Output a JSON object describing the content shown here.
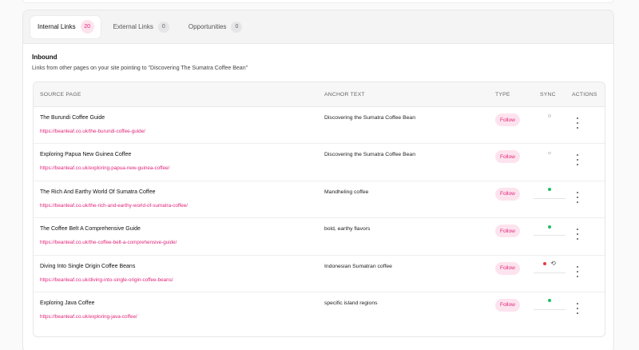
{
  "tabs": [
    {
      "label": "Internal Links",
      "count": "20"
    },
    {
      "label": "External Links",
      "count": "0"
    },
    {
      "label": "Opportunities",
      "count": "0"
    }
  ],
  "section": {
    "title": "Inbound",
    "description": "Links from other pages on your site pointing to \"Discovering The Sumatra Coffee Bean\""
  },
  "table": {
    "headers": {
      "source": "SOURCE PAGE",
      "anchor": "ANCHOR TEXT",
      "type": "TYPE",
      "sync": "SYNC",
      "actions": "ACTIONS"
    },
    "rows": [
      {
        "title": "The Burundi Coffee Guide",
        "url": "https://beanleaf.co.uk/the-burundi-coffee-guide/",
        "anchor": "Discovering the Sumatra Coffee Bean",
        "type": "Follow",
        "sync": "pending",
        "sync_icon": "refresh-icon"
      },
      {
        "title": "Exploring Papua New Guinea Coffee",
        "url": "https://beanleaf.co.uk/exploring-papua-new-guinea-coffee/",
        "anchor": "Discovering the Sumatra Coffee Bean",
        "type": "Follow",
        "sync": "pending",
        "sync_icon": "refresh-icon"
      },
      {
        "title": "The Rich And Earthy World Of Sumatra Coffee",
        "url": "https://beanleaf.co.uk/the-rich-and-earthy-world-of-sumatra-coffee/",
        "anchor": "Mandheling coffee",
        "type": "Follow",
        "sync": "synced",
        "sync_icon": "refresh-icon"
      },
      {
        "title": "The Coffee Belt A Comprehensive Guide",
        "url": "https://beanleaf.co.uk/the-coffee-belt-a-comprehensive-guide/",
        "anchor": "bold, earthy flavors",
        "type": "Follow",
        "sync": "synced",
        "sync_icon": "refresh-icon"
      },
      {
        "title": "Diving Into Single Origin Coffee Beans",
        "url": "https://beanleaf.co.uk/diving-into-single-origin-coffee-beans/",
        "anchor": "Indonesian Sumatran coffee",
        "type": "Follow",
        "sync": "error",
        "sync_icon": "refresh-icon",
        "sync_glyph": "⟲"
      },
      {
        "title": "Exploring Java Coffee",
        "url": "https://beanleaf.co.uk/exploring-java-coffee/",
        "anchor": "specific island regions",
        "type": "Follow",
        "sync": "synced",
        "sync_icon": "refresh-icon"
      }
    ]
  },
  "colors": {
    "accent": "#e0257a",
    "accent_bg": "#fde3ee",
    "synced": "#1fbf62",
    "error": "#e23b3b"
  }
}
